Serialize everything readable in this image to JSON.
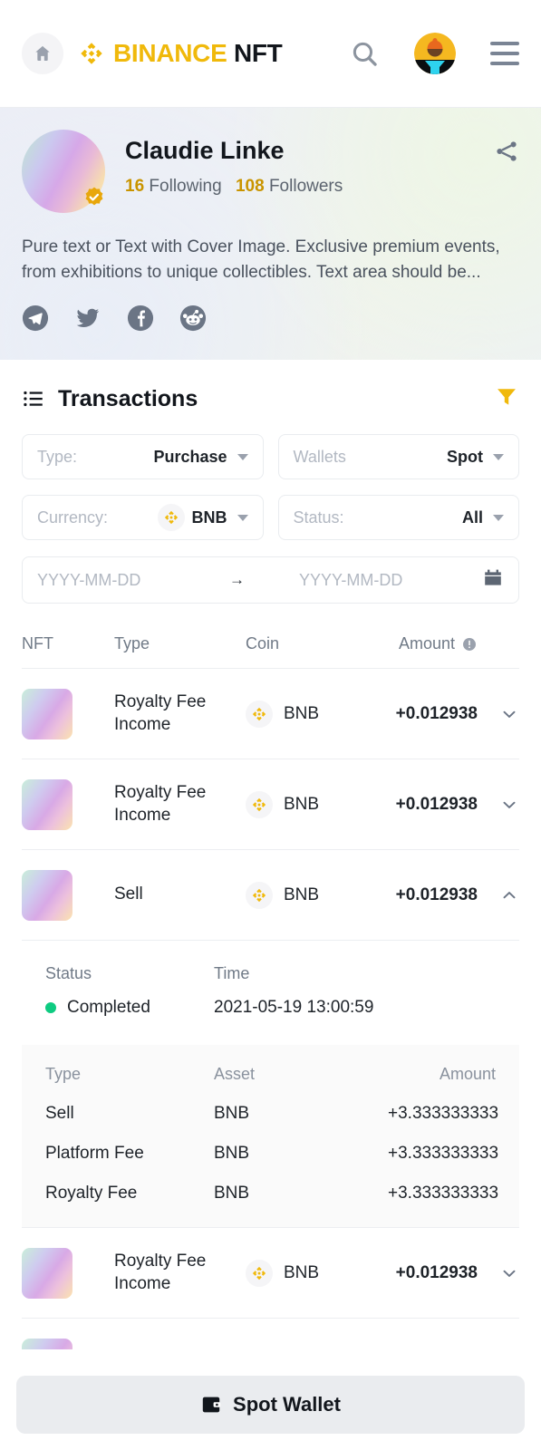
{
  "header": {
    "home_icon": "home-icon",
    "brand_binance": "BINANCE",
    "brand_nft": "NFT",
    "search_icon": "search-icon",
    "avatar_icon": "user-avatar",
    "menu_icon": "hamburger-menu-icon"
  },
  "profile": {
    "name": "Claudie Linke",
    "following_count": "16",
    "following_label": "Following",
    "followers_count": "108",
    "followers_label": "Followers",
    "bio": "Pure text or Text with Cover Image. Exclusive premium events, from exhibitions to unique collectibles. Text area should be...",
    "verified_badge": "verified-badge-icon",
    "share_icon": "share-icon",
    "socials": [
      {
        "name": "telegram-icon"
      },
      {
        "name": "twitter-icon"
      },
      {
        "name": "facebook-icon"
      },
      {
        "name": "reddit-icon"
      }
    ]
  },
  "transactions": {
    "title": "Transactions",
    "list_icon": "list-icon",
    "filter_icon": "filter-funnel-icon",
    "accent_color": "#F0B90B",
    "filters": [
      {
        "label": "Type:",
        "value": "Purchase",
        "has_coin_icon": false
      },
      {
        "label": "Wallets",
        "value": "Spot",
        "has_coin_icon": false
      },
      {
        "label": "Currency:",
        "value": "BNB",
        "has_coin_icon": true
      },
      {
        "label": "Status:",
        "value": "All",
        "has_coin_icon": false
      }
    ],
    "date_range": {
      "start_placeholder": "YYYY-MM-DD",
      "end_placeholder": "YYYY-MM-DD",
      "start_value": "",
      "end_value": "",
      "arrow": "→",
      "calendar_icon": "calendar-icon"
    },
    "columns": {
      "nft": "NFT",
      "type": "Type",
      "coin": "Coin",
      "amount": "Amount",
      "amount_info_icon": "info-icon"
    },
    "rows": [
      {
        "type": "Royalty Fee Income",
        "coin": "BNB",
        "amount": "+0.012938",
        "expanded": false
      },
      {
        "type": "Royalty Fee Income",
        "coin": "BNB",
        "amount": "+0.012938",
        "expanded": false
      },
      {
        "type": "Sell",
        "coin": "BNB",
        "amount": "+0.012938",
        "expanded": true
      },
      {
        "type": "Royalty Fee Income",
        "coin": "BNB",
        "amount": "+0.012938",
        "expanded": false
      }
    ],
    "detail": {
      "status_label": "Status",
      "status_value": "Completed",
      "status_color": "#0ECB81",
      "time_label": "Time",
      "time_value": "2021-05-19 13:00:59",
      "sub_columns": {
        "type": "Type",
        "asset": "Asset",
        "amount": "Amount"
      },
      "sub_rows": [
        {
          "type": "Sell",
          "asset": "BNB",
          "amount": "+3.333333333"
        },
        {
          "type": "Platform Fee",
          "asset": "BNB",
          "amount": "+3.333333333"
        },
        {
          "type": "Royalty Fee",
          "asset": "BNB",
          "amount": "+3.333333333"
        }
      ]
    }
  },
  "bottom_bar": {
    "spot_wallet_label": "Spot Wallet",
    "wallet_icon": "wallet-icon"
  }
}
